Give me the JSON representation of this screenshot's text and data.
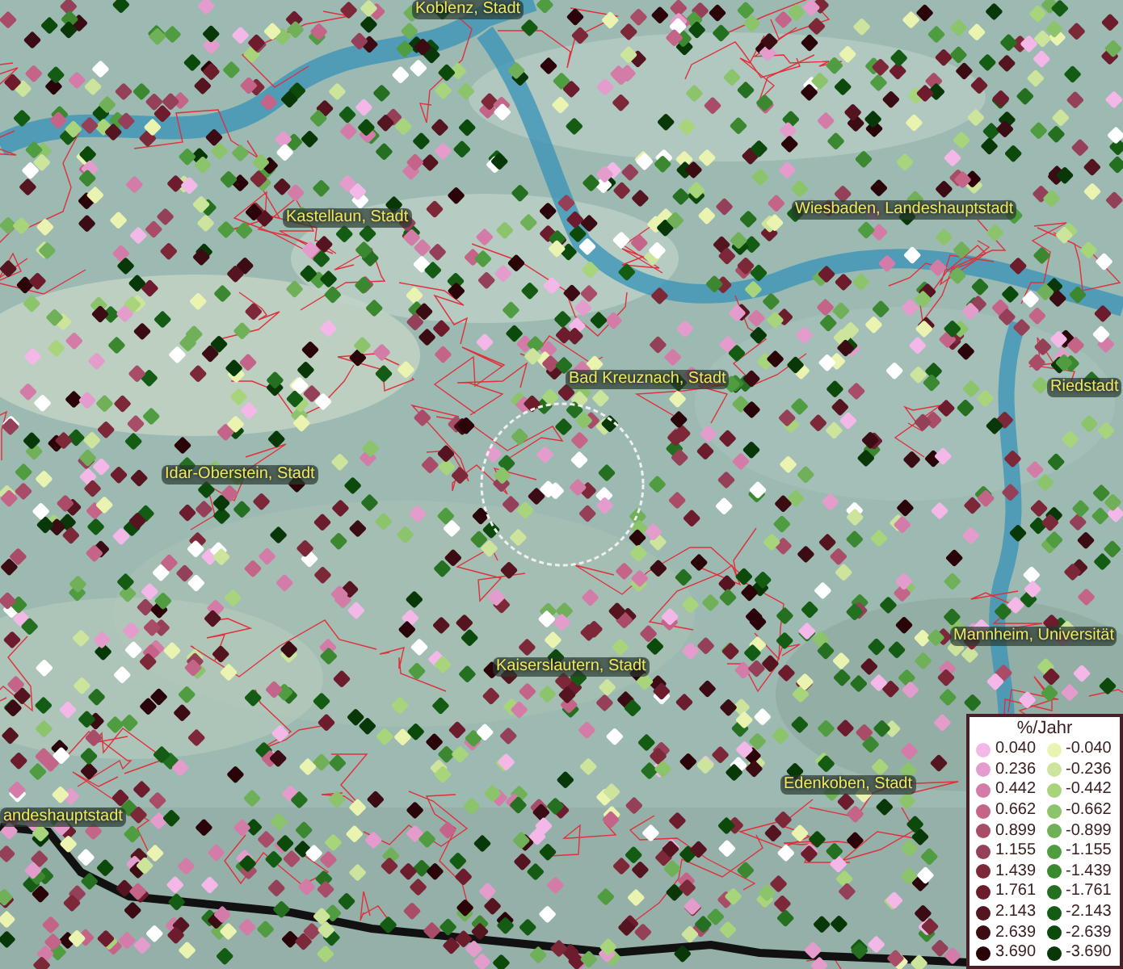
{
  "map": {
    "place_labels": [
      "Koblenz, Stadt",
      "Kastellaun, Stadt",
      "Wiesbaden, Landeshauptstadt",
      "Bad Kreuznach, Stadt",
      "Riedstadt",
      "Idar-Oberstein, Stadt",
      "Kaiserslautern, Stadt",
      "Mannheim, Universität",
      "Edenkoben, Stadt",
      "andeshauptstadt"
    ]
  },
  "legend": {
    "title": "%/Jahr",
    "positive": [
      {
        "value": "0.040",
        "color": "#f4b8e8"
      },
      {
        "value": "0.236",
        "color": "#e49ccc"
      },
      {
        "value": "0.442",
        "color": "#d47ca8"
      },
      {
        "value": "0.662",
        "color": "#c46488"
      },
      {
        "value": "0.899",
        "color": "#a84c68"
      },
      {
        "value": "1.155",
        "color": "#944058"
      },
      {
        "value": "1.439",
        "color": "#7c2838"
      },
      {
        "value": "1.761",
        "color": "#6c1c2c"
      },
      {
        "value": "2.143",
        "color": "#541420"
      },
      {
        "value": "2.639",
        "color": "#3c0c14"
      },
      {
        "value": "3.690",
        "color": "#2a0408"
      }
    ],
    "negative": [
      {
        "value": "-0.040",
        "color": "#eaf4b0"
      },
      {
        "value": "-0.236",
        "color": "#cce49c"
      },
      {
        "value": "-0.442",
        "color": "#a8d47c"
      },
      {
        "value": "-0.662",
        "color": "#8cc46c"
      },
      {
        "value": "-0.899",
        "color": "#70b058"
      },
      {
        "value": "-1.155",
        "color": "#509c40"
      },
      {
        "value": "-1.439",
        "color": "#3c8830"
      },
      {
        "value": "-1.761",
        "color": "#247020"
      },
      {
        "value": "-2.143",
        "color": "#145c14"
      },
      {
        "value": "-2.639",
        "color": "#0c4a0c"
      },
      {
        "value": "-3.690",
        "color": "#083808"
      }
    ]
  }
}
